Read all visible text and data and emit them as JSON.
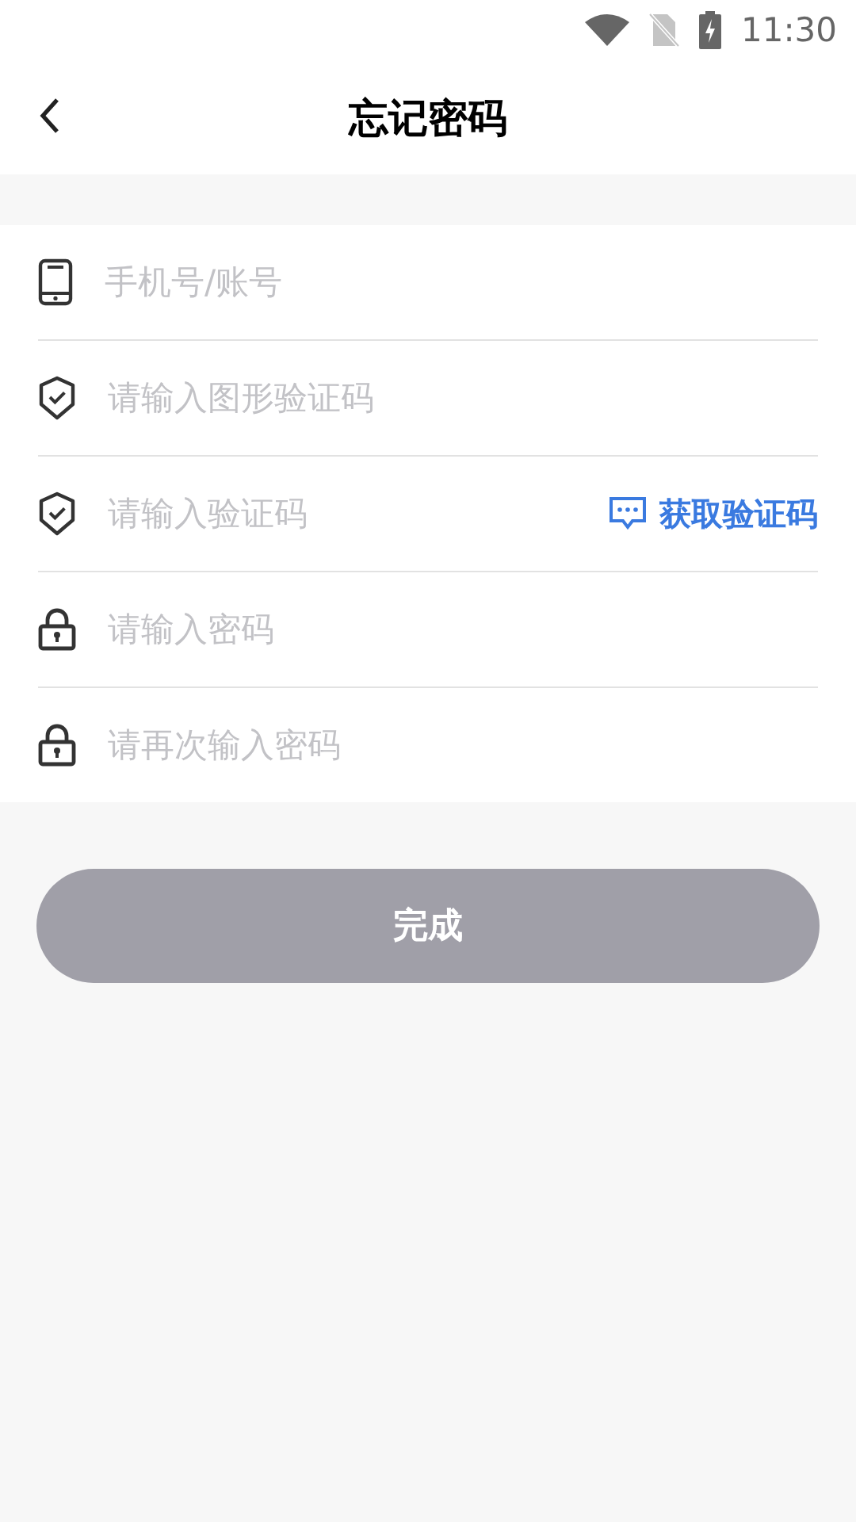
{
  "status_bar": {
    "time": "11:30"
  },
  "header": {
    "title": "忘记密码"
  },
  "fields": [
    {
      "kind": "phone",
      "placeholder": "手机号/账号"
    },
    {
      "kind": "shield",
      "placeholder": "请输入图形验证码"
    },
    {
      "kind": "shield",
      "placeholder": "请输入验证码",
      "action": "获取验证码"
    },
    {
      "kind": "lock",
      "placeholder": "请输入密码"
    },
    {
      "kind": "lock",
      "placeholder": "请再次输入密码"
    }
  ],
  "submit": {
    "label": "完成",
    "disabled": true
  }
}
